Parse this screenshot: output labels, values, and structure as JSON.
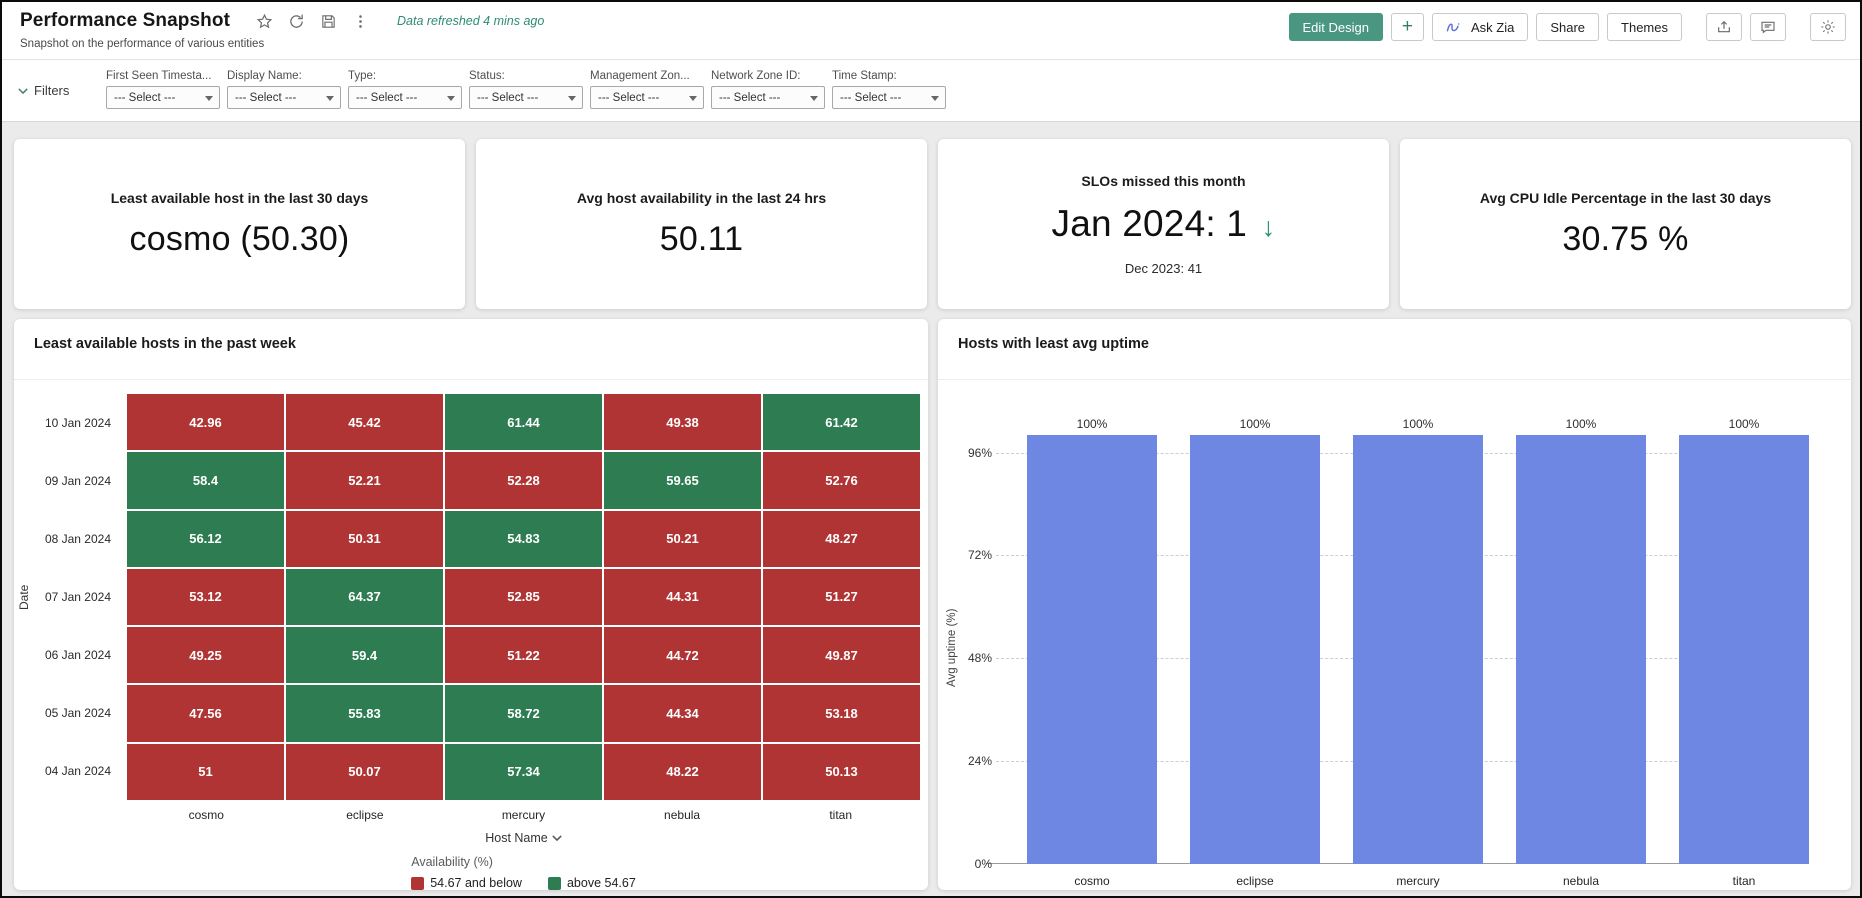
{
  "header": {
    "title": "Performance Snapshot",
    "subtitle": "Snapshot on the performance of various entities",
    "refresh_status": "Data refreshed 4 mins ago",
    "buttons": {
      "edit_design": "Edit Design",
      "add": "+",
      "ask_zia": "Ask Zia",
      "share": "Share",
      "themes": "Themes"
    },
    "colors": {
      "accent_green": "#4a9781",
      "refresh_text": "#2e8b74",
      "zia_blue": "#5b6fd6"
    }
  },
  "filters": {
    "label": "Filters",
    "select_placeholder": "--- Select ---",
    "items": [
      {
        "label": "First Seen Timesta..."
      },
      {
        "label": "Display Name:"
      },
      {
        "label": "Type:"
      },
      {
        "label": "Status:"
      },
      {
        "label": "Management Zon..."
      },
      {
        "label": "Network Zone ID:"
      },
      {
        "label": "Time Stamp:"
      }
    ]
  },
  "kpis": [
    {
      "title": "Least available host in the last 30 days",
      "value": "cosmo (50.30)"
    },
    {
      "title": "Avg host availability in the last 24 hrs",
      "value": "50.11"
    },
    {
      "title": "SLOs missed this month",
      "value": "Jan 2024: 1",
      "trend": "down",
      "trend_glyph": "↓",
      "subvalue": "Dec 2023: 41"
    },
    {
      "title": "Avg CPU Idle Percentage in the last 30 days",
      "value": "30.75 %"
    }
  ],
  "chart_data": [
    {
      "type": "heatmap",
      "title": "Least available hosts in the past week",
      "xlabel": "Host Name",
      "ylabel": "Date",
      "categories": [
        "cosmo",
        "eclipse",
        "mercury",
        "nebula",
        "titan"
      ],
      "rows": [
        "10 Jan 2024",
        "09 Jan 2024",
        "08 Jan 2024",
        "07 Jan 2024",
        "06 Jan 2024",
        "05 Jan 2024",
        "04 Jan 2024"
      ],
      "values": [
        [
          42.96,
          45.42,
          61.44,
          49.38,
          61.42
        ],
        [
          58.4,
          52.21,
          52.28,
          59.65,
          52.76
        ],
        [
          56.12,
          50.31,
          54.83,
          50.21,
          48.27
        ],
        [
          53.12,
          64.37,
          52.85,
          44.31,
          51.27
        ],
        [
          49.25,
          59.4,
          51.22,
          44.72,
          49.87
        ],
        [
          47.56,
          55.83,
          58.72,
          44.34,
          53.18
        ],
        [
          51,
          50.07,
          57.34,
          48.22,
          50.13
        ]
      ],
      "legend": {
        "title": "Availability (%)",
        "threshold": 54.67,
        "low_label": "54.67 and below",
        "high_label": "above 54.67",
        "low_color": "#b13434",
        "high_color": "#2e7d52"
      }
    },
    {
      "type": "bar",
      "title": "Hosts with least avg uptime",
      "ylabel": "Avg uptime (%)",
      "categories": [
        "cosmo",
        "eclipse",
        "mercury",
        "nebula",
        "titan"
      ],
      "values": [
        100,
        100,
        100,
        100,
        100
      ],
      "bar_labels": [
        "100%",
        "100%",
        "100%",
        "100%",
        "100%"
      ],
      "yticks": [
        0,
        24,
        48,
        72,
        96
      ],
      "ytick_labels": [
        "0%",
        "24%",
        "48%",
        "72%",
        "96%"
      ],
      "ylim": [
        0,
        100.8
      ],
      "grid": "dashed",
      "legend_position": "none",
      "bar_color": "#6d87e2"
    }
  ]
}
